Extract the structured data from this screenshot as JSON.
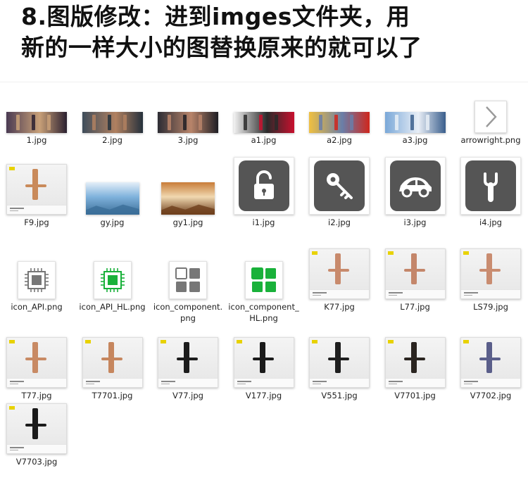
{
  "heading": {
    "line1": "8.图版修改：进到imges文件夹，用",
    "line2": "新的一样大小的图替换原来的就可以了"
  },
  "files": [
    {
      "name": "1.jpg",
      "kind": "banner",
      "colors": [
        "#4a3a52",
        "#c8a078",
        "#2b2030"
      ]
    },
    {
      "name": "2.jpg",
      "kind": "banner",
      "colors": [
        "#3e4c5a",
        "#b08060",
        "#25313c"
      ]
    },
    {
      "name": "3.jpg",
      "kind": "banner",
      "colors": [
        "#2c2c34",
        "#b8846a",
        "#1e1e24"
      ]
    },
    {
      "name": "a1.jpg",
      "kind": "banner",
      "colors": [
        "#f2f2f2",
        "#2a2a2a",
        "#c8102e"
      ]
    },
    {
      "name": "a2.jpg",
      "kind": "banner",
      "colors": [
        "#f0c040",
        "#6a7ea8",
        "#d0261c"
      ]
    },
    {
      "name": "a3.jpg",
      "kind": "banner",
      "colors": [
        "#7aa8d8",
        "#e8eef6",
        "#3a5e8c"
      ]
    },
    {
      "name": "arrowright.png",
      "kind": "arrow"
    },
    {
      "name": "F9.jpg",
      "kind": "lock",
      "plate": "#c98a5a"
    },
    {
      "name": "gy.jpg",
      "kind": "photo",
      "colors": [
        "#7fb2dc",
        "#e4eef8",
        "#3b6e98"
      ]
    },
    {
      "name": "gy1.jpg",
      "kind": "photo",
      "colors": [
        "#f0d8b0",
        "#c87c38",
        "#6e3e1c"
      ]
    },
    {
      "name": "i1.jpg",
      "kind": "icon",
      "icon": "padlock-icon"
    },
    {
      "name": "i2.jpg",
      "kind": "icon",
      "icon": "key-icon"
    },
    {
      "name": "i3.jpg",
      "kind": "icon",
      "icon": "car-icon"
    },
    {
      "name": "i4.jpg",
      "kind": "icon",
      "icon": "wrench-icon"
    },
    {
      "name": "icon_API.png",
      "kind": "chip",
      "color": "#777777"
    },
    {
      "name": "icon_API_HL.png",
      "kind": "chip",
      "color": "#19b13a"
    },
    {
      "name": "icon_component.png",
      "kind": "blocks",
      "color": "#777777"
    },
    {
      "name": "icon_component_HL.png",
      "kind": "blocks",
      "color": "#19b13a"
    },
    {
      "name": "K77.jpg",
      "kind": "lock",
      "plate": "#c88a6c"
    },
    {
      "name": "L77.jpg",
      "kind": "lock",
      "plate": "#c4866a"
    },
    {
      "name": "LS79.jpg",
      "kind": "lock",
      "plate": "#c98c70"
    },
    {
      "name": "T77.jpg",
      "kind": "lock",
      "plate": "#c88a64"
    },
    {
      "name": "T7701.jpg",
      "kind": "lock",
      "plate": "#c6865e"
    },
    {
      "name": "V77.jpg",
      "kind": "lock",
      "plate": "#1c1c1c"
    },
    {
      "name": "V177.jpg",
      "kind": "lock",
      "plate": "#1a1a1a"
    },
    {
      "name": "V551.jpg",
      "kind": "lock",
      "plate": "#1e1e1e"
    },
    {
      "name": "V7701.jpg",
      "kind": "lock",
      "plate": "#2a2420"
    },
    {
      "name": "V7702.jpg",
      "kind": "lock",
      "plate": "#5a5e8a"
    },
    {
      "name": "V7703.jpg",
      "kind": "lock",
      "plate": "#1a1a1a"
    }
  ]
}
